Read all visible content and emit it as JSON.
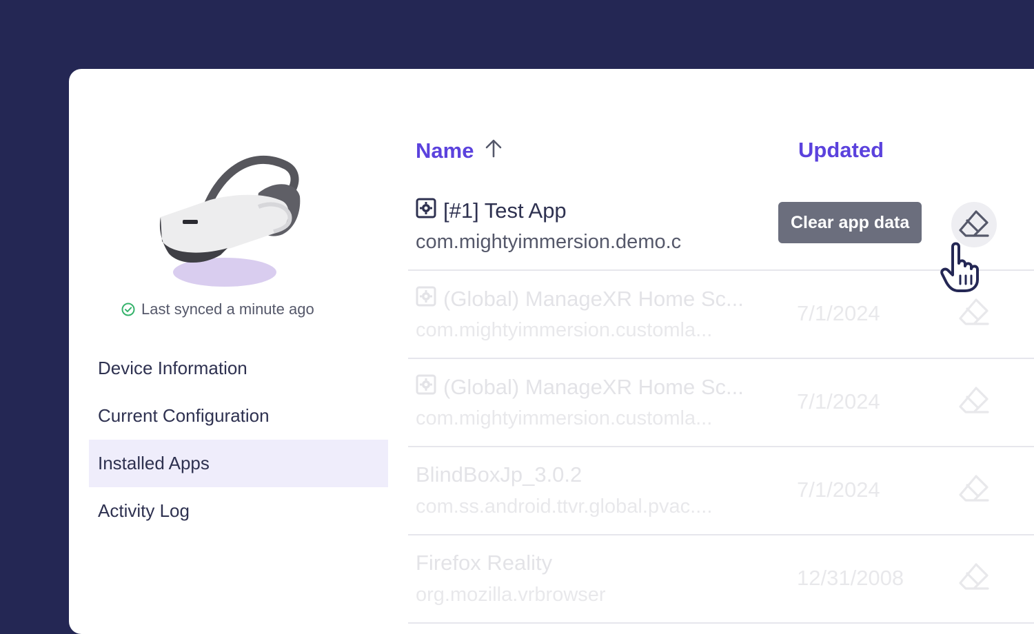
{
  "sidebar": {
    "sync_status": "Last synced a minute ago",
    "nav_items": [
      {
        "label": "Device Information",
        "active": false
      },
      {
        "label": "Current Configuration",
        "active": false
      },
      {
        "label": "Installed Apps",
        "active": true
      },
      {
        "label": "Activity Log",
        "active": false
      }
    ]
  },
  "table": {
    "columns": {
      "name": "Name",
      "updated": "Updated"
    },
    "sort": {
      "column": "Name",
      "direction": "ascending",
      "icon": "arrow-up-icon"
    },
    "rows": [
      {
        "name": "[#1] Test App",
        "package": "com.mightyimmersion.demo.c",
        "updated": "",
        "has_icon": true,
        "hovered": true
      },
      {
        "name": "(Global) ManageXR Home Sc...",
        "package": "com.mightyimmersion.customla...",
        "updated": "7/1/2024",
        "has_icon": true,
        "hovered": false
      },
      {
        "name": "(Global) ManageXR Home Sc...",
        "package": "com.mightyimmersion.customla...",
        "updated": "7/1/2024",
        "has_icon": true,
        "hovered": false
      },
      {
        "name": "BlindBoxJp_3.0.2",
        "package": "com.ss.android.ttvr.global.pvac....",
        "updated": "7/1/2024",
        "has_icon": false,
        "hovered": false
      },
      {
        "name": "Firefox Reality",
        "package": "org.mozilla.vrbrowser",
        "updated": "12/31/2008",
        "has_icon": false,
        "hovered": false
      }
    ],
    "tooltip": "Clear app data",
    "action_icon": "eraser-icon"
  },
  "colors": {
    "background": "#242754",
    "accent": "#5b42dd",
    "active_nav": "#efedfb",
    "sync_ok": "#34b26a",
    "tooltip_bg": "#6b6e7d"
  }
}
